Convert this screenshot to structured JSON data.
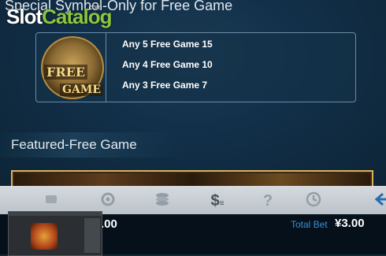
{
  "header": {
    "section_title": "Special Symbol-Only for Free Game",
    "watermark_part1": "Slot",
    "watermark_part2": "Catalog",
    "watermark_part3": ".com"
  },
  "special_symbol": {
    "icon": "sphinx-free-game-symbol",
    "label_line1": "FREE",
    "label_line2": "GAME",
    "payouts": [
      "Any 5  Free Game 15",
      "Any 4  Free Game 10",
      "Any 3  Free Game 7"
    ]
  },
  "featured": {
    "title": "Featured-Free Game"
  },
  "toolbar": {
    "icons": [
      "autoplay-icon",
      "settings-icon",
      "coins-icon",
      "paytable-dollar-icon",
      "help-icon",
      "history-icon",
      "back-arrow-icon"
    ],
    "help_glyph": "?",
    "dollar_glyph": "$"
  },
  "footer": {
    "balance_value": ".00",
    "total_bet_label": "Total Bet",
    "total_bet_value": "¥3.00"
  },
  "colors": {
    "accent": "#3a8fd8",
    "watermark_green": "#8cc63f",
    "frame_gold": "#d9b15a"
  }
}
